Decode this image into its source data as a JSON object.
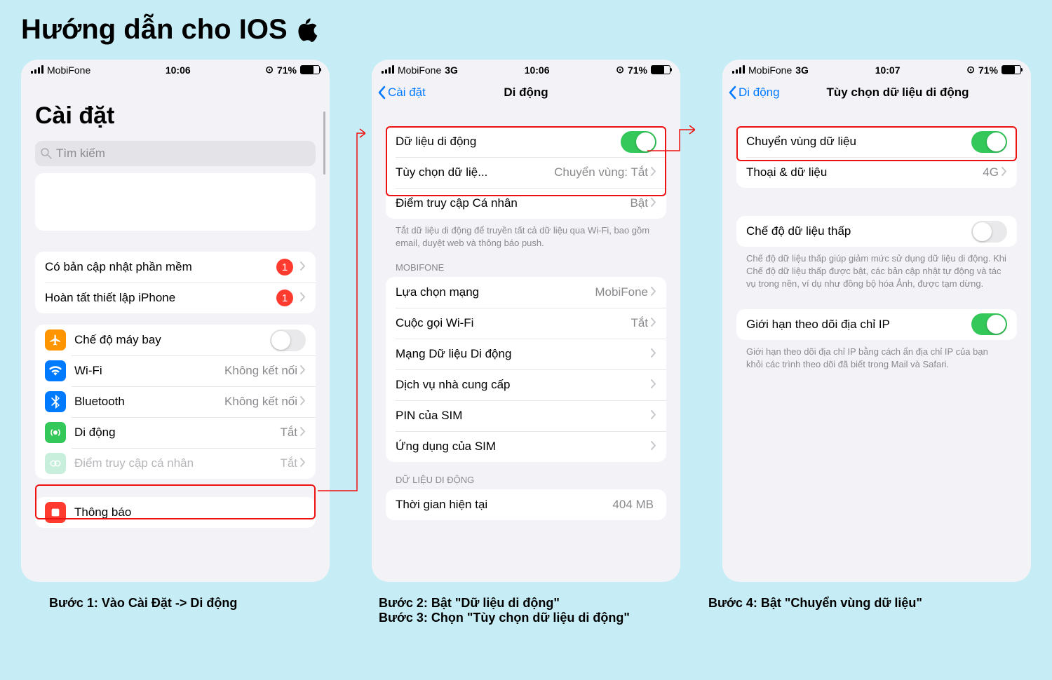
{
  "title": "Hướng dẫn cho IOS",
  "status1": {
    "carrier": "MobiFone",
    "net": "",
    "time": "10:06",
    "bat": "71%"
  },
  "status2": {
    "carrier": "MobiFone",
    "net": "3G",
    "time": "10:06",
    "bat": "71%"
  },
  "status3": {
    "carrier": "MobiFone",
    "net": "3G",
    "time": "10:07",
    "bat": "71%"
  },
  "screen1": {
    "title": "Cài đặt",
    "search": "Tìm kiếm",
    "rows": {
      "update": {
        "label": "Có bản cập nhật phần mềm",
        "badge": "1"
      },
      "finish": {
        "label": "Hoàn tất thiết lập iPhone",
        "badge": "1"
      },
      "airplane": {
        "label": "Chế độ máy bay"
      },
      "wifi": {
        "label": "Wi-Fi",
        "value": "Không kết nối"
      },
      "bt": {
        "label": "Bluetooth",
        "value": "Không kết nối"
      },
      "cellular": {
        "label": "Di động",
        "value": "Tắt"
      },
      "hotspot": {
        "label": "Điểm truy cập cá nhân",
        "value": "Tắt"
      },
      "notif": {
        "label": "Thông báo"
      }
    }
  },
  "screen2": {
    "back": "Cài đặt",
    "title": "Di động",
    "rows": {
      "data": {
        "label": "Dữ liệu di động"
      },
      "opts": {
        "label": "Tùy chọn dữ liệ...",
        "value": "Chuyển vùng: Tắt"
      },
      "hotspot": {
        "label": "Điểm truy cập Cá nhân",
        "value": "Bật"
      }
    },
    "note1": "Tắt dữ liệu di động để truyền tất cả dữ liệu qua Wi-Fi, bao gồm email, duyệt web và thông báo push.",
    "header_mob": "MOBIFONE",
    "rows2": {
      "net": {
        "label": "Lựa chọn mạng",
        "value": "MobiFone"
      },
      "wificall": {
        "label": "Cuộc gọi Wi-Fi",
        "value": "Tắt"
      },
      "datanet": {
        "label": "Mạng Dữ liệu Di động"
      },
      "provider": {
        "label": "Dịch vụ nhà cung cấp"
      },
      "simpin": {
        "label": "PIN của SIM"
      },
      "simapp": {
        "label": "Ứng dụng của SIM"
      }
    },
    "header_data": "DỮ LIỆU DI ĐỘNG",
    "current": {
      "label": "Thời gian hiện tại",
      "value": "404 MB"
    }
  },
  "screen3": {
    "back": "Di động",
    "title": "Tùy chọn dữ liệu di động",
    "rows": {
      "roam": {
        "label": "Chuyển vùng dữ liệu"
      },
      "voice": {
        "label": "Thoại & dữ liệu",
        "value": "4G"
      },
      "low": {
        "label": "Chế độ dữ liệu thấp"
      },
      "iplimit": {
        "label": "Giới hạn theo dõi địa chỉ IP"
      }
    },
    "note_low": "Chế độ dữ liệu thấp giúp giảm mức sử dụng dữ liệu di động. Khi Chế độ dữ liệu thấp được bật, các bản cập nhật tự động và tác vụ trong nền, ví dụ như đồng bộ hóa Ảnh, được tạm dừng.",
    "note_ip": "Giới hạn theo dõi địa chỉ IP bằng cách ẩn địa chỉ IP của bạn khỏi các trình theo dõi đã biết trong Mail và Safari."
  },
  "captions": {
    "c1": "Bước 1: Vào Cài Đặt -> Di động",
    "c2a": "Bước 2: Bật \"Dữ liệu di động\"",
    "c2b": "Bước 3: Chọn \"Tùy chọn dữ liệu di động\"",
    "c3": "Bước 4: Bật \"Chuyển vùng dữ liệu\""
  }
}
